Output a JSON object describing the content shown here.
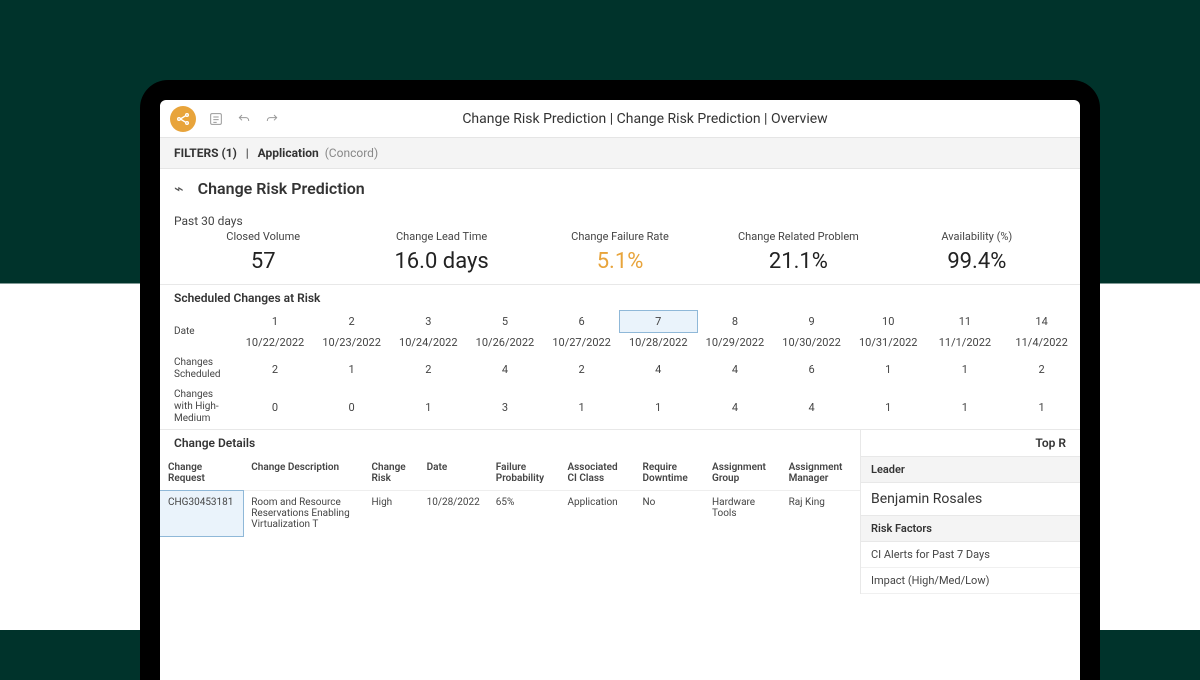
{
  "breadcrumb": "Change Risk Prediction | Change Risk Prediction | Overview",
  "filters": {
    "label": "FILTERS (1)",
    "sep": "|",
    "key": "Application",
    "value": "(Concord)"
  },
  "page_title": "Change Risk Prediction",
  "past30_label": "Past 30 days",
  "kpis": [
    {
      "label": "Closed Volume",
      "value": "57",
      "warn": false
    },
    {
      "label": "Change Lead Time",
      "value": "16.0 days",
      "warn": false
    },
    {
      "label": "Change Failure Rate",
      "value": "5.1%",
      "warn": true
    },
    {
      "label": "Change Related Problem",
      "value": "21.1%",
      "warn": false
    },
    {
      "label": "Availability (%)",
      "value": "99.4%",
      "warn": false
    }
  ],
  "scheduled_title": "Scheduled Changes at Risk",
  "date_label": "Date",
  "columns": [
    {
      "count": "1",
      "date": "10/22/2022",
      "selected": false
    },
    {
      "count": "2",
      "date": "10/23/2022",
      "selected": false
    },
    {
      "count": "3",
      "date": "10/24/2022",
      "selected": false
    },
    {
      "count": "5",
      "date": "10/26/2022",
      "selected": false
    },
    {
      "count": "6",
      "date": "10/27/2022",
      "selected": false
    },
    {
      "count": "7",
      "date": "10/28/2022",
      "selected": true
    },
    {
      "count": "8",
      "date": "10/29/2022",
      "selected": false
    },
    {
      "count": "9",
      "date": "10/30/2022",
      "selected": false
    },
    {
      "count": "10",
      "date": "10/31/2022",
      "selected": false
    },
    {
      "count": "11",
      "date": "11/1/2022",
      "selected": false
    },
    {
      "count": "14",
      "date": "11/4/2022",
      "selected": false
    }
  ],
  "rows": [
    {
      "label": "Changes Scheduled",
      "values": [
        "2",
        "1",
        "2",
        "4",
        "2",
        "4",
        "4",
        "6",
        "1",
        "1",
        "2"
      ]
    },
    {
      "label": "Changes with High-Medium",
      "values": [
        "0",
        "0",
        "1",
        "3",
        "1",
        "1",
        "4",
        "4",
        "1",
        "1",
        "1"
      ]
    }
  ],
  "change_details_title": "Change Details",
  "top_label": "Top R",
  "cd_headers": [
    "Change Request",
    "Change Description",
    "Change Risk",
    "Date",
    "Failure Probability",
    "Associated CI Class",
    "Require Downtime",
    "Assignment Group",
    "Assignment Manager"
  ],
  "cd_row": {
    "request": "CHG30453181",
    "description": "Room and Resource Reservations Enabling Virtualization T",
    "risk": "High",
    "date": "10/28/2022",
    "probability": "65%",
    "ci_class": "Application",
    "downtime": "No",
    "group": "Hardware Tools",
    "manager": "Raj King"
  },
  "right": {
    "leader_label": "Leader",
    "leader_value": "Benjamin Rosales",
    "risk_factors_label": "Risk Factors",
    "items": [
      "CI Alerts for Past 7 Days",
      "Impact (High/Med/Low)"
    ]
  }
}
